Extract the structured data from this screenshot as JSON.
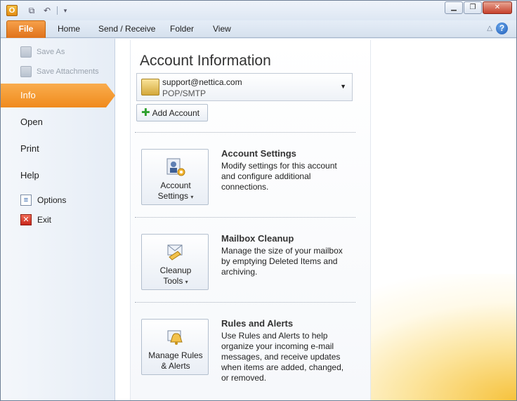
{
  "window": {
    "app_icon_letter": "O",
    "caption_buttons": {
      "minimize": "▁",
      "restore": "❐",
      "close": "✕"
    }
  },
  "tabs": {
    "file": "File",
    "items": [
      "Home",
      "Send / Receive",
      "Folder",
      "View"
    ],
    "help": "?"
  },
  "sidebar": {
    "save_as": "Save As",
    "save_attachments": "Save Attachments",
    "info": "Info",
    "open": "Open",
    "print": "Print",
    "help": "Help",
    "options": "Options",
    "exit": "Exit"
  },
  "main": {
    "title": "Account Information",
    "account": {
      "email": "support@nettica.com",
      "type": "POP/SMTP"
    },
    "add_account": "Add Account",
    "sections": [
      {
        "button_line1": "Account",
        "button_line2": "Settings",
        "title": "Account Settings",
        "desc": "Modify settings for this account and configure additional connections."
      },
      {
        "button_line1": "Cleanup",
        "button_line2": "Tools",
        "title": "Mailbox Cleanup",
        "desc": "Manage the size of your mailbox by emptying Deleted Items and archiving."
      },
      {
        "button_line1": "Manage Rules",
        "button_line2": "& Alerts",
        "title": "Rules and Alerts",
        "desc": "Use Rules and Alerts to help organize your incoming e-mail messages, and receive updates when items are added, changed, or removed."
      }
    ]
  },
  "colors": {
    "file_tab": "#e0721a",
    "active_nav": "#f08a1c",
    "accent_swirl": "#f5bc28"
  }
}
